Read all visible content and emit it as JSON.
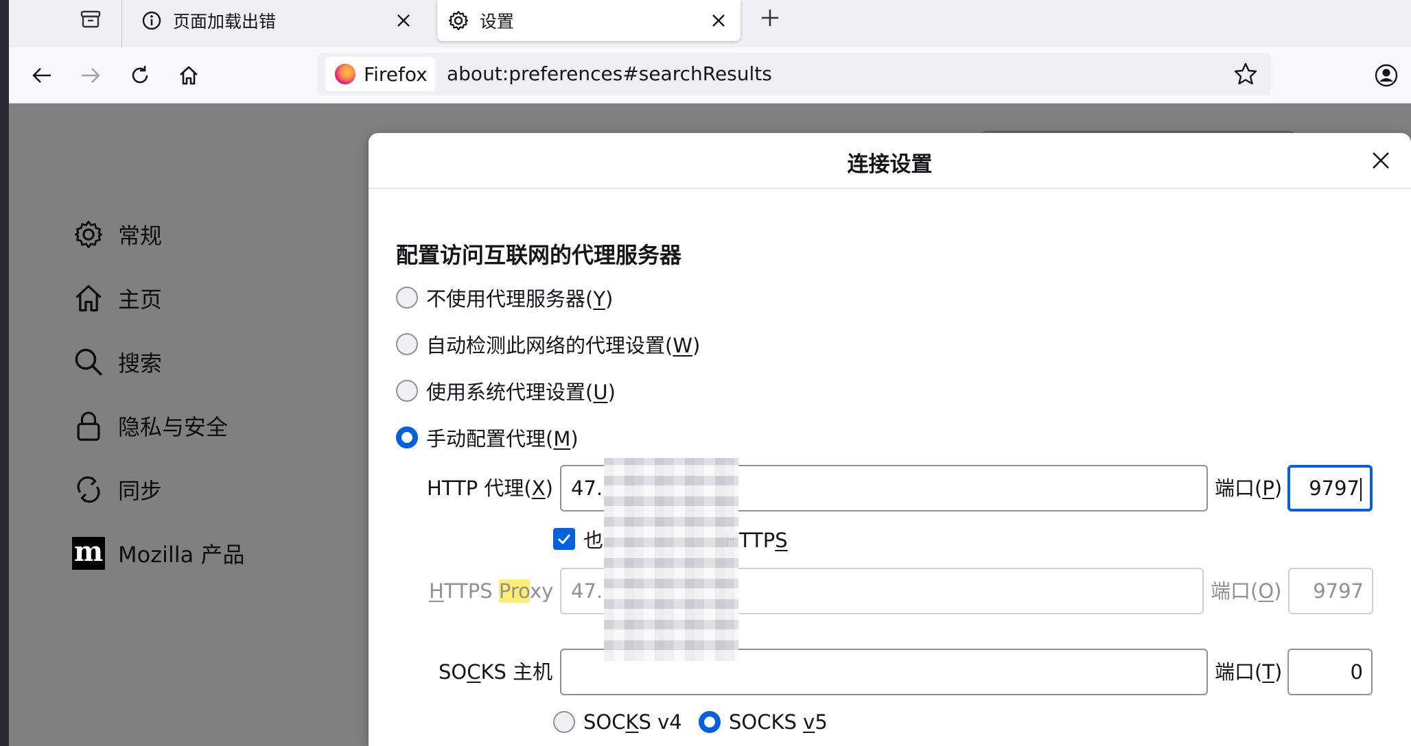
{
  "tabs": [
    {
      "label": "页面加载出错",
      "icon": "info-icon"
    },
    {
      "label": "设置",
      "icon": "gear-icon"
    }
  ],
  "navbar": {
    "identity_label": "Firefox",
    "url": "about:preferences#searchResults"
  },
  "sidebar": {
    "items": [
      {
        "label": "常规",
        "icon": "gear-icon"
      },
      {
        "label": "主页",
        "icon": "home-icon"
      },
      {
        "label": "搜索",
        "icon": "search-icon"
      },
      {
        "label": "隐私与安全",
        "icon": "lock-icon"
      },
      {
        "label": "同步",
        "icon": "sync-icon"
      },
      {
        "label": "Mozilla 产品",
        "icon": "mozilla-icon"
      }
    ]
  },
  "dialog": {
    "title": "连接设置",
    "section_title": "配置访问互联网的代理服务器",
    "radios": [
      {
        "text": "不使用代理服务器(",
        "key": "Y",
        "checked": false
      },
      {
        "text": "自动检测此网络的代理设置(",
        "key": "W",
        "checked": false
      },
      {
        "text": "使用系统代理设置(",
        "key": "U",
        "checked": false
      },
      {
        "text": "手动配置代理(",
        "key": "M",
        "checked": true
      }
    ],
    "http": {
      "label_pre": "HTTP 代理(",
      "label_key": "X",
      "value": "47.",
      "port_label_pre": "端口(",
      "port_key": "P",
      "port": "9797"
    },
    "also_https": {
      "prefix": "也",
      "suffix_pre": "HTTP",
      "suffix_key": "S",
      "checked": true
    },
    "https": {
      "label_pre_key": "H",
      "label_mid": "TTPS ",
      "label_highlight": "Pro",
      "label_post": "xy",
      "value": "47.",
      "port_label_pre": "端口(",
      "port_key": "O",
      "port": "9797"
    },
    "socks": {
      "label_pre": "SO",
      "label_key": "C",
      "label_post": "KS 主机",
      "value": "",
      "port_label_pre": "端口(",
      "port_key": "T",
      "port": "0",
      "v4_pre": "SOC",
      "v4_key": "K",
      "v4_post": "S v4",
      "v5_pre": "SOCKS ",
      "v5_key": "v",
      "v5_post": "5",
      "v5_checked": true
    },
    "close_paren": ")"
  },
  "colors": {
    "accent": "#0061e0",
    "content_overlay": "#808080",
    "highlight": "#ffee70"
  }
}
